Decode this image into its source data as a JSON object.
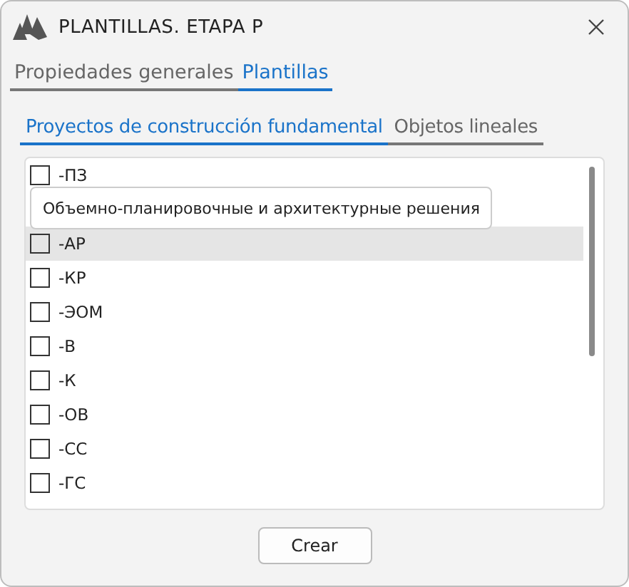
{
  "window": {
    "title": "PLANTILLAS. ETAPA P"
  },
  "tabs": [
    {
      "label": "Propiedades generales",
      "selected": false
    },
    {
      "label": "Plantillas",
      "selected": true
    }
  ],
  "subtabs": [
    {
      "label": "Proyectos de construcción fundamental",
      "selected": true
    },
    {
      "label": "Objetos lineales",
      "selected": false
    }
  ],
  "items": [
    {
      "label": "-ПЗ",
      "checked": false,
      "highlighted": false
    },
    {
      "kind": "tooltip",
      "text": "Объемно-планировочные и архитектурные решения"
    },
    {
      "label": "-АР",
      "checked": false,
      "highlighted": true
    },
    {
      "label": "-КР",
      "checked": false,
      "highlighted": false
    },
    {
      "label": "-ЭОМ",
      "checked": false,
      "highlighted": false
    },
    {
      "label": "-В",
      "checked": false,
      "highlighted": false
    },
    {
      "label": "-К",
      "checked": false,
      "highlighted": false
    },
    {
      "label": "-ОВ",
      "checked": false,
      "highlighted": false
    },
    {
      "label": "-СС",
      "checked": false,
      "highlighted": false
    },
    {
      "label": "-ГС",
      "checked": false,
      "highlighted": false
    }
  ],
  "buttons": [
    "Crear"
  ]
}
